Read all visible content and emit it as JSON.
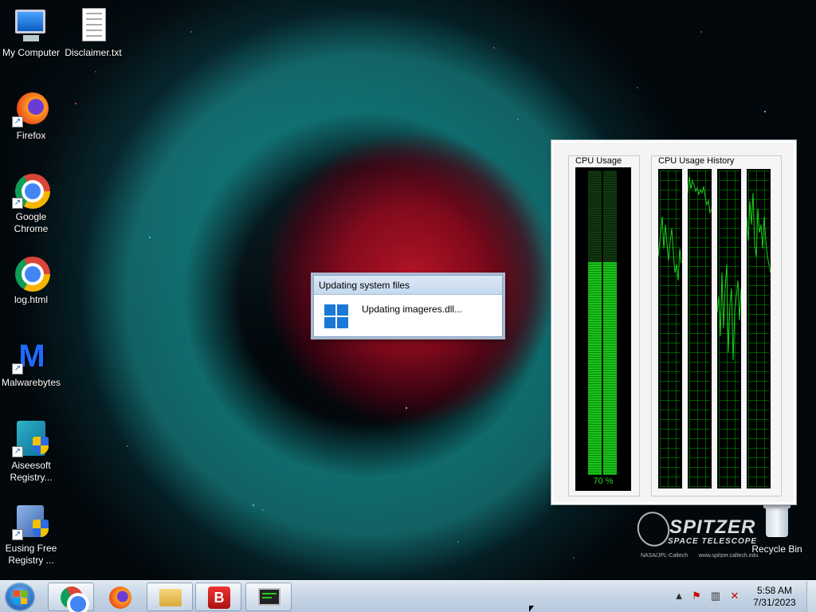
{
  "desktop": {
    "icons": [
      {
        "label": "My Computer",
        "icon": "computer-icon"
      },
      {
        "label": "Disclaimer.txt",
        "icon": "text-file-icon"
      },
      {
        "label": "Firefox",
        "icon": "firefox-icon"
      },
      {
        "label": "Google Chrome",
        "icon": "chrome-icon"
      },
      {
        "label": "log.html",
        "icon": "chrome-html-icon"
      },
      {
        "label": "Malwarebytes",
        "icon": "malwarebytes-icon"
      },
      {
        "label": "Aiseesoft Registry...",
        "icon": "registry-cleaner-icon"
      },
      {
        "label": "Eusing Free Registry ...",
        "icon": "registry-cleaner-icon"
      }
    ],
    "recycle_bin": {
      "label": "Recycle Bin",
      "icon": "recycle-bin-icon"
    }
  },
  "dialog": {
    "title": "Updating system files",
    "message": "Updating imageres.dll...",
    "icon": "windows-logo-icon"
  },
  "cpu_gadget": {
    "usage_title": "CPU Usage",
    "history_title": "CPU Usage History",
    "usage_value": 0.7,
    "usage_label": "70 %",
    "bar_color": "#19c419"
  },
  "wallpaper": {
    "line1": "SPITZER",
    "line2": "SPACE TELESCOPE",
    "credit_left": "NASA/JPL-Caltech",
    "credit_right": "www.spitzer.caltech.edu"
  },
  "taskbar": {
    "buttons": [
      {
        "name": "Google Chrome",
        "icon": "chrome-icon"
      },
      {
        "name": "Firefox",
        "icon": "firefox-icon"
      },
      {
        "name": "Windows Explorer",
        "icon": "folder-icon"
      },
      {
        "name": "Registry tool",
        "icon": "registry-tool-icon"
      },
      {
        "name": "CPU Meter",
        "icon": "monitor-icon"
      }
    ],
    "tray_icons": [
      "chevron-up-icon",
      "action-center-icon",
      "network-icon",
      "volume-muted-icon"
    ],
    "time": "5:58 AM",
    "date": "7/31/2023"
  }
}
